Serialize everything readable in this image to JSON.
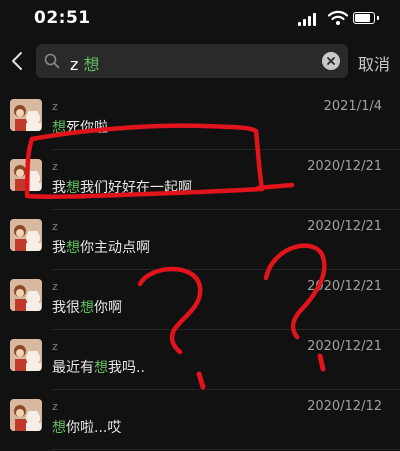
{
  "status_bar": {
    "time": "02:51"
  },
  "search": {
    "prefix": "z ",
    "keyword": "想"
  },
  "header": {
    "cancel_label": "取消"
  },
  "results": [
    {
      "sender": "z",
      "pre": "",
      "kw": "想",
      "post": "死你啦",
      "date": "2021/1/4"
    },
    {
      "sender": "z",
      "pre": "我",
      "kw": "想",
      "post": "我们好好在一起啊",
      "date": "2020/12/21"
    },
    {
      "sender": "z",
      "pre": "我",
      "kw": "想",
      "post": "你主动点啊",
      "date": "2020/12/21"
    },
    {
      "sender": "z",
      "pre": "我很",
      "kw": "想",
      "post": "你啊",
      "date": "2020/12/21"
    },
    {
      "sender": "z",
      "pre": "最近有",
      "kw": "想",
      "post": "我吗..",
      "date": "2020/12/21"
    },
    {
      "sender": "z",
      "pre": "",
      "kw": "想",
      "post": "你啦...哎",
      "date": "2020/12/12"
    }
  ],
  "colors": {
    "background": "#111111",
    "keyword_highlight": "#5fbf5f",
    "annotation": "#e1131b"
  },
  "icons": [
    "back-chevron-icon",
    "search-icon",
    "clear-icon",
    "signal-icon",
    "wifi-icon",
    "battery-icon"
  ]
}
